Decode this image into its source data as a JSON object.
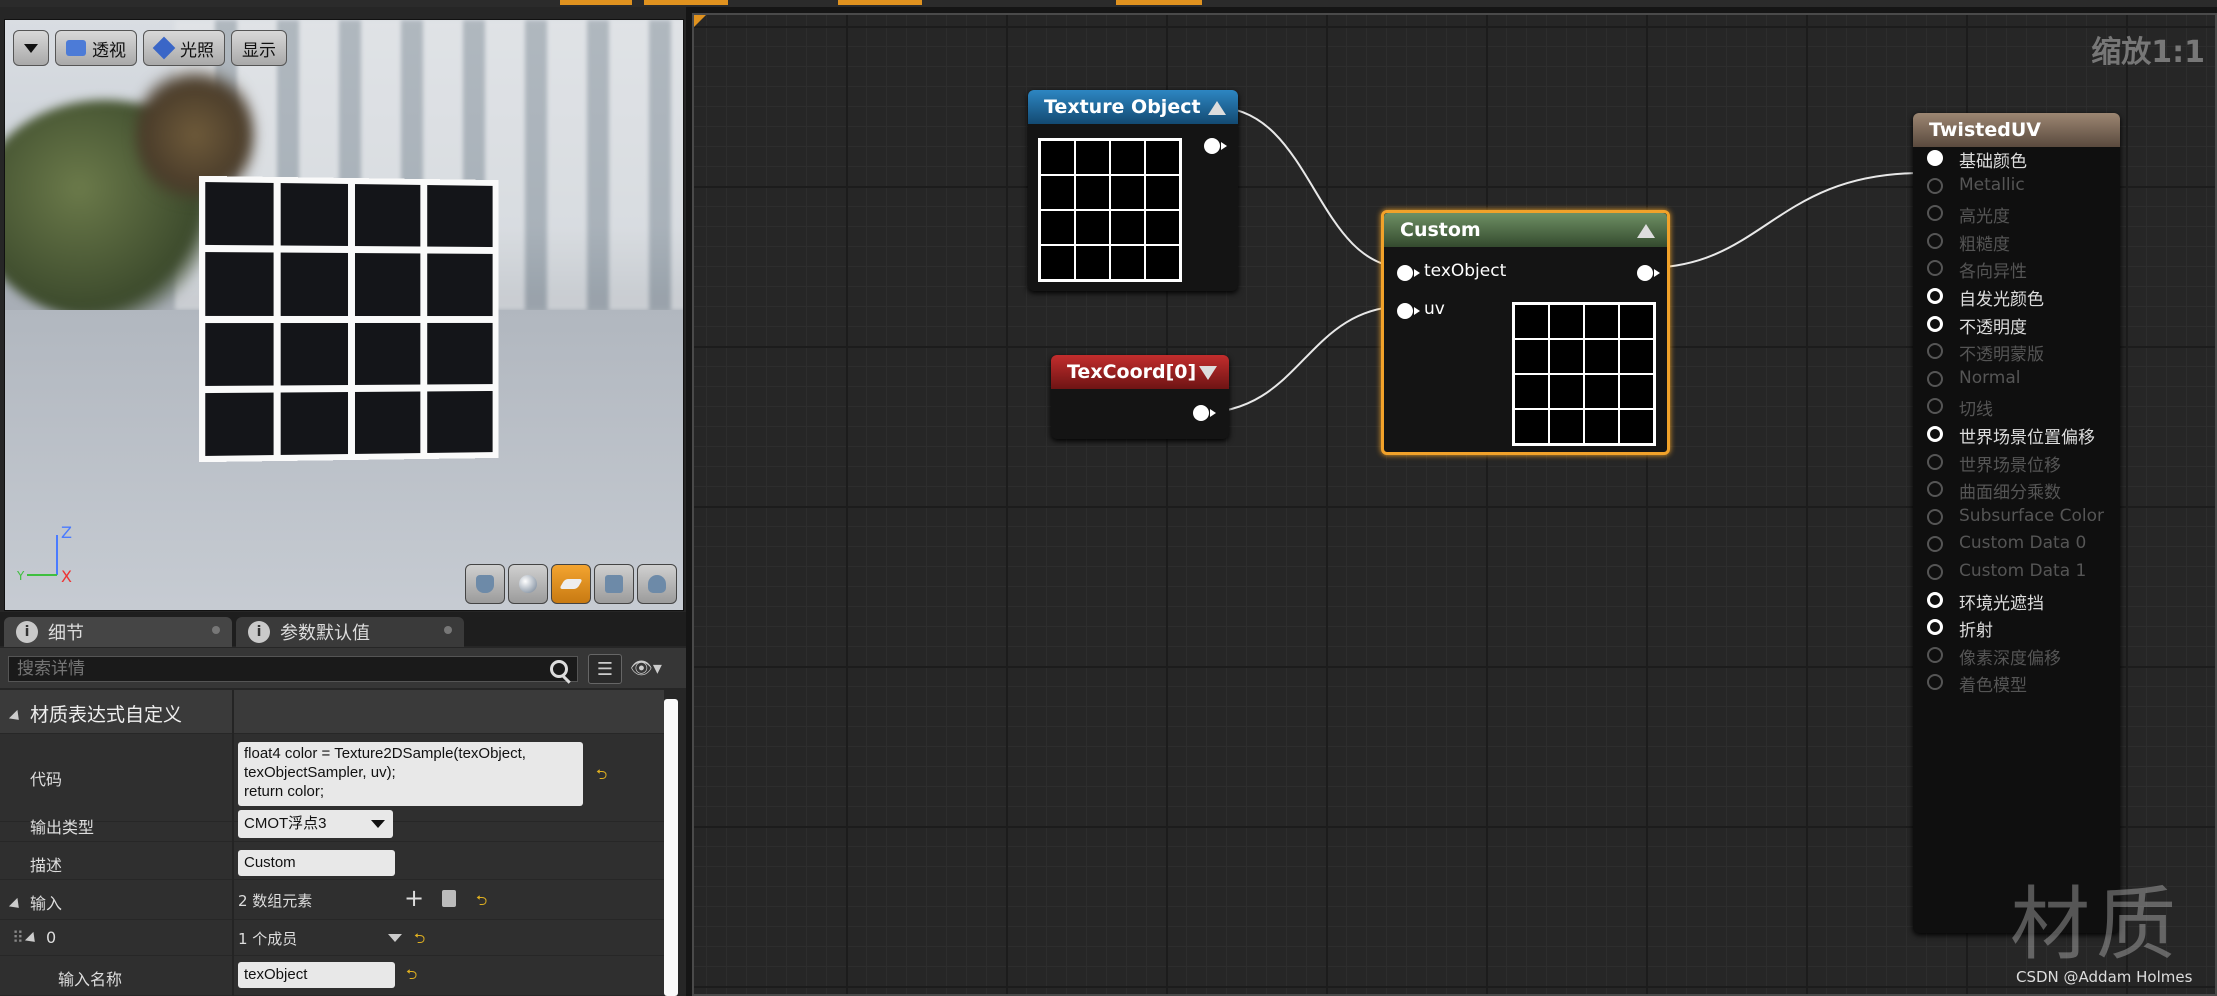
{
  "viewport": {
    "toolbar": {
      "perspective": "透视",
      "lighting": "光照",
      "show": "显示"
    },
    "axis": {
      "z": "Z",
      "x": "X",
      "y": "Y"
    }
  },
  "details": {
    "tabs": [
      "细节",
      "参数默认值"
    ],
    "search_placeholder": "搜索详情",
    "category": "材质表达式自定义",
    "code_label": "代码",
    "code_value": "float4 color = Texture2DSample(texObject,\ntexObjectSampler, uv);\nreturn color;",
    "output_type_label": "输出类型",
    "output_type_value": "CMOT浮点3",
    "description_label": "描述",
    "description_value": "Custom",
    "inputs_label": "输入",
    "inputs_value": "2 数组元素",
    "input0_label": "0",
    "input0_value": "1 个成员",
    "input_name_label": "输入名称",
    "input_name_value": "texObject"
  },
  "graph": {
    "zoom": "缩放1:1",
    "nodes": {
      "texture_object": {
        "title": "Texture Object",
        "color": "#1e6fa0"
      },
      "texcoord": {
        "title": "TexCoord[0]",
        "color": "#9a1d1d"
      },
      "custom": {
        "title": "Custom",
        "color": "#4f6f45",
        "inputs": [
          "texObject",
          "uv"
        ]
      },
      "twisted": {
        "title": "TwistedUV"
      }
    },
    "outputs": [
      {
        "label": "基础颜色",
        "active": true,
        "connected": true
      },
      {
        "label": "Metallic",
        "active": false
      },
      {
        "label": "高光度",
        "active": false
      },
      {
        "label": "粗糙度",
        "active": false
      },
      {
        "label": "各向异性",
        "active": false
      },
      {
        "label": "自发光颜色",
        "active": true
      },
      {
        "label": "不透明度",
        "active": true
      },
      {
        "label": "不透明蒙版",
        "active": false
      },
      {
        "label": "Normal",
        "active": false
      },
      {
        "label": "切线",
        "active": false
      },
      {
        "label": "世界场景位置偏移",
        "active": true
      },
      {
        "label": "世界场景位移",
        "active": false
      },
      {
        "label": "曲面细分乘数",
        "active": false
      },
      {
        "label": "Subsurface Color",
        "active": false
      },
      {
        "label": "Custom Data 0",
        "active": false
      },
      {
        "label": "Custom Data 1",
        "active": false
      },
      {
        "label": "环境光遮挡",
        "active": true
      },
      {
        "label": "折射",
        "active": true
      },
      {
        "label": "像素深度偏移",
        "active": false
      },
      {
        "label": "着色模型",
        "active": false
      }
    ]
  },
  "watermark": "材质",
  "credit": "CSDN @Addam Holmes"
}
